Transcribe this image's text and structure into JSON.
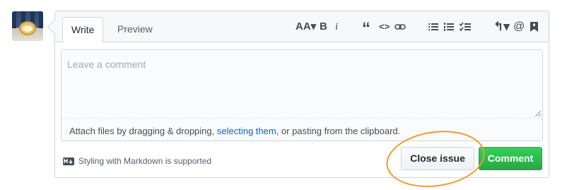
{
  "tabs": {
    "write": "Write",
    "preview": "Preview"
  },
  "toolbar": {
    "text_size_glyph": "AA▾",
    "bold_glyph": "B",
    "italic_glyph": "i",
    "quote_glyph": "“",
    "code_glyph": "<>",
    "reply_glyph": "↰▾",
    "mention_glyph": "@"
  },
  "editor": {
    "placeholder": "Leave a comment",
    "attach_before": "Attach files by dragging & dropping, ",
    "attach_link": "selecting them",
    "attach_after": ", or pasting from the clipboard."
  },
  "footer": {
    "markdown_note": "Styling with Markdown is supported",
    "close_issue_label": "Close issue",
    "comment_label": "Comment"
  },
  "colors": {
    "primary_green": "#28a745",
    "highlight_orange": "#f39a2a",
    "link_blue": "#0366d6"
  }
}
